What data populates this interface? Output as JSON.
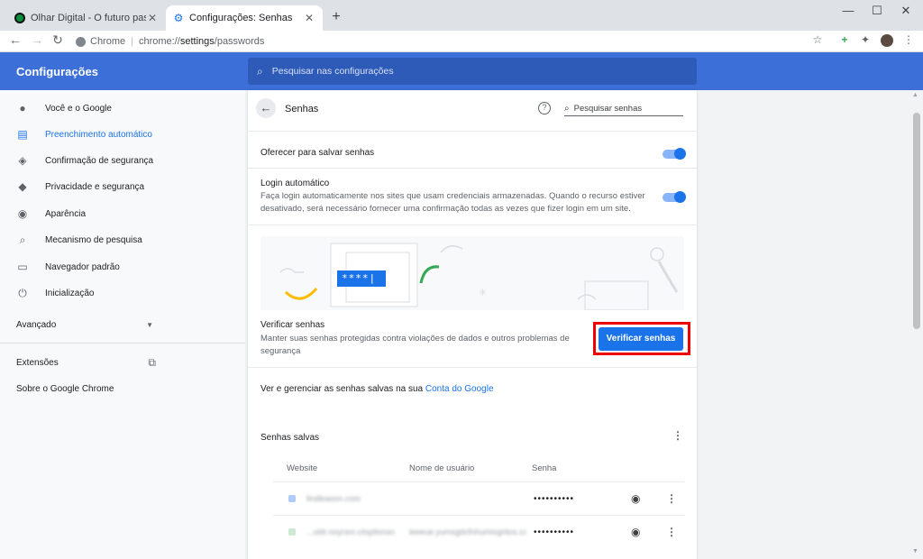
{
  "tabs": [
    {
      "title": "Olhar Digital - O futuro passa pr",
      "active": false
    },
    {
      "title": "Configurações: Senhas",
      "active": true
    }
  ],
  "window": {
    "new_tab": "+",
    "minimize": "—",
    "maximize": "☐",
    "close": "✕"
  },
  "toolbar": {
    "back": "←",
    "forward": "→",
    "reload": "↻",
    "site_label": "Chrome",
    "url_scheme": "chrome://",
    "url_path": "settings",
    "url_rest": "/passwords"
  },
  "header": {
    "title": "Configurações",
    "search_placeholder": "Pesquisar nas configurações"
  },
  "sidebar": {
    "items": [
      {
        "label": "Você e o Google",
        "icon": "person-icon"
      },
      {
        "label": "Preenchimento automático",
        "icon": "clipboard-icon",
        "selected": true
      },
      {
        "label": "Confirmação de segurança",
        "icon": "shield-check-icon"
      },
      {
        "label": "Privacidade e segurança",
        "icon": "shield-icon"
      },
      {
        "label": "Aparência",
        "icon": "palette-icon"
      },
      {
        "label": "Mecanismo de pesquisa",
        "icon": "search-icon"
      },
      {
        "label": "Navegador padrão",
        "icon": "browser-icon"
      },
      {
        "label": "Inicialização",
        "icon": "power-icon"
      }
    ],
    "advanced": "Avançado",
    "extensions": "Extensões",
    "about": "Sobre o Google Chrome"
  },
  "passwords": {
    "title": "Senhas",
    "search_placeholder": "Pesquisar senhas",
    "offer_save": "Oferecer para salvar senhas",
    "auto_login_title": "Login automático",
    "auto_login_desc_1": "Faça login automaticamente nos sites que usam credenciais armazenadas. Quando o recurso estiver",
    "auto_login_desc_2": "desativado, será necessário fornecer uma confirmação todas as vezes que fizer login em um site.",
    "check_title": "Verificar senhas",
    "check_desc_1": "Manter suas senhas protegidas contra violações de dados e outros problemas de",
    "check_desc_2": "segurança",
    "check_button": "Verificar senhas",
    "illustration_stars": "****",
    "manage_text": "Ver e gerenciar as senhas salvas na sua",
    "manage_link": "Conta do Google",
    "saved_title": "Senhas salvas",
    "columns": [
      "Website",
      "Nome de usuário",
      "Senha"
    ],
    "rows": [
      {
        "site": "lindleason.com",
        "user": "",
        "password": "••••••••••"
      },
      {
        "site": "...uldr.noyrsnr.ciisplionsn",
        "user": "ieeeue.yumsgdcfnhumiogritos.co..",
        "password": "••••••••••"
      }
    ]
  },
  "colors": {
    "accent": "#1a73e8",
    "header": "#3c6fd8",
    "highlight": "#e00000"
  }
}
